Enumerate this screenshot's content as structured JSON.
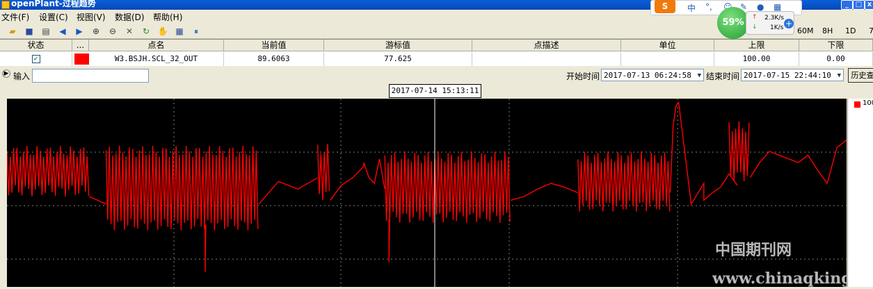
{
  "window": {
    "title": "openPlant-过程趋势"
  },
  "menu": [
    "文件(F)",
    "设置(C)",
    "视图(V)",
    "数据(D)",
    "帮助(H)"
  ],
  "toolbar": {
    "icons": [
      "open-icon",
      "save-icon",
      "print-icon",
      "prev-icon",
      "next-icon",
      "zoom-in-icon",
      "zoom-out-icon",
      "tools-icon",
      "refresh-icon",
      "pan-hand-icon",
      "table-icon",
      "pause-icon"
    ],
    "ranges": [
      "60M",
      "8H",
      "1D",
      "7"
    ]
  },
  "grid": {
    "headers": [
      "状态",
      "...",
      "点名",
      "当前值",
      "游标值",
      "点描述",
      "单位",
      "上限",
      "下限"
    ],
    "row": {
      "status_checked": true,
      "color": "#ff0000",
      "name": "W3.BSJH.SCL_32_OUT",
      "current": "89.6063",
      "cursor": "77.625",
      "desc": "",
      "unit": "",
      "upper": "100.00",
      "lower": "0.00"
    }
  },
  "inputrow": {
    "input_label": "输入",
    "start_label": "开始时间",
    "start_value": "2017-07-13  06:24:58",
    "end_label": "结束时间",
    "end_value": "2017-07-15  22:44:10",
    "history_button": "历史查"
  },
  "chart_data": {
    "type": "line",
    "cursor_time": "2017-07-14  15:13:11",
    "legend": [
      {
        "name": "100",
        "color": "#ff0000"
      }
    ],
    "ylim": [
      0,
      100
    ],
    "grid": true,
    "series": [
      {
        "name": "W3.BSJH.SCL_32_OUT",
        "color": "#ff0000",
        "segments": [
          {
            "x": [
              0.0,
              0.098
            ],
            "type": "osc",
            "lo": 48,
            "hi": 75
          },
          {
            "x": [
              0.098,
              0.118
            ],
            "type": "line",
            "v": [
              48,
              44
            ]
          },
          {
            "x": [
              0.118,
              0.3
            ],
            "type": "osc",
            "lo": 30,
            "hi": 75
          },
          {
            "x": [
              0.236,
              0.236
            ],
            "type": "spike",
            "v": [
              33,
              8
            ]
          },
          {
            "x": [
              0.3,
              0.37
            ],
            "type": "line",
            "v": [
              44,
              56,
              52,
              58
            ]
          },
          {
            "x": [
              0.37,
              0.385
            ],
            "type": "osc",
            "lo": 46,
            "hi": 76
          },
          {
            "x": [
              0.385,
              0.425
            ],
            "type": "line",
            "v": [
              46,
              54,
              58,
              64
            ]
          },
          {
            "x": [
              0.425,
              0.45
            ],
            "type": "line",
            "v": [
              66,
              58,
              55,
              68,
              52
            ]
          },
          {
            "x": [
              0.45,
              0.6
            ],
            "type": "osc",
            "lo": 34,
            "hi": 72
          },
          {
            "x": [
              0.455,
              0.455
            ],
            "type": "spike",
            "v": [
              36,
              13
            ]
          },
          {
            "x": [
              0.6,
              0.68
            ],
            "type": "line",
            "v": [
              46,
              48,
              52,
              55,
              53,
              50
            ]
          },
          {
            "x": [
              0.68,
              0.79
            ],
            "type": "osc",
            "lo": 40,
            "hi": 72
          },
          {
            "x": [
              0.79,
              0.8
            ],
            "type": "line",
            "v": [
              50,
              85,
              96,
              98
            ]
          },
          {
            "x": [
              0.8,
              0.83
            ],
            "type": "line",
            "v": [
              98,
              44,
              55
            ]
          },
          {
            "x": [
              0.83,
              0.87
            ],
            "type": "line",
            "v": [
              46,
              50,
              53,
              60,
              54
            ]
          },
          {
            "x": [
              0.86,
              0.885
            ],
            "type": "osc",
            "lo": 56,
            "hi": 88
          },
          {
            "x": [
              0.885,
              1.0
            ],
            "type": "line",
            "v": [
              58,
              66,
              72,
              70,
              68,
              66,
              70,
              62,
              55,
              74,
              78
            ]
          }
        ]
      }
    ]
  },
  "watermark": {
    "cn": "中国期刊网",
    "url": "www.chinaqking.com"
  },
  "overlay": {
    "ime": "S",
    "percent": "59%",
    "up": "2.3K/s",
    "down": "1K/s"
  }
}
